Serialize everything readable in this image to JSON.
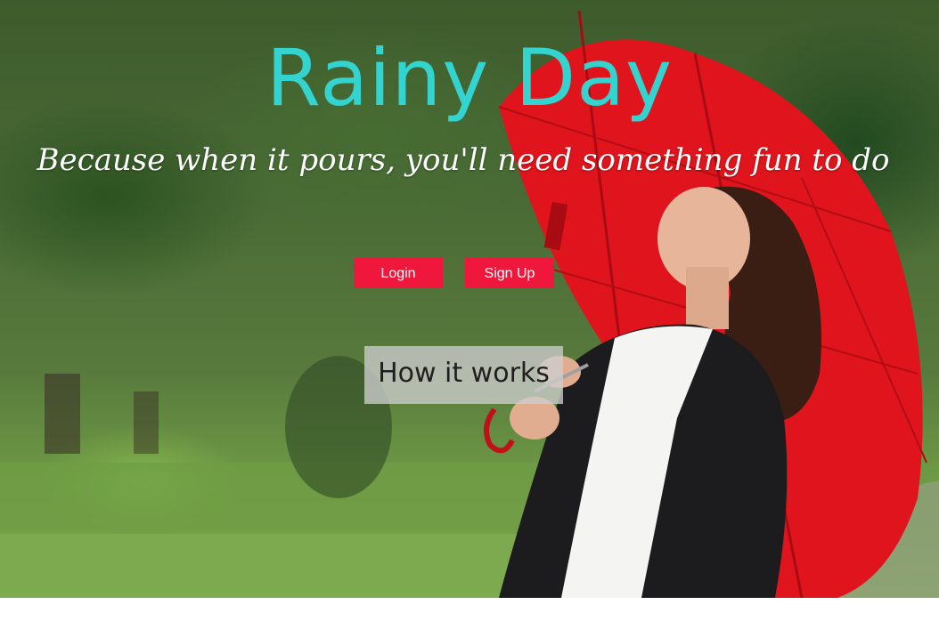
{
  "hero": {
    "title": "Rainy Day",
    "tagline": "Because when it pours, you'll need something fun to do",
    "photo_description_icon": "woman-with-red-umbrella-image"
  },
  "buttons": {
    "login_label": "Login",
    "signup_label": "Sign Up",
    "how_label": "How it works"
  },
  "colors": {
    "title": "#33d3cf",
    "button_bg": "#f0173c",
    "button_text": "#ffffff",
    "umbrella": "#e0141c"
  }
}
